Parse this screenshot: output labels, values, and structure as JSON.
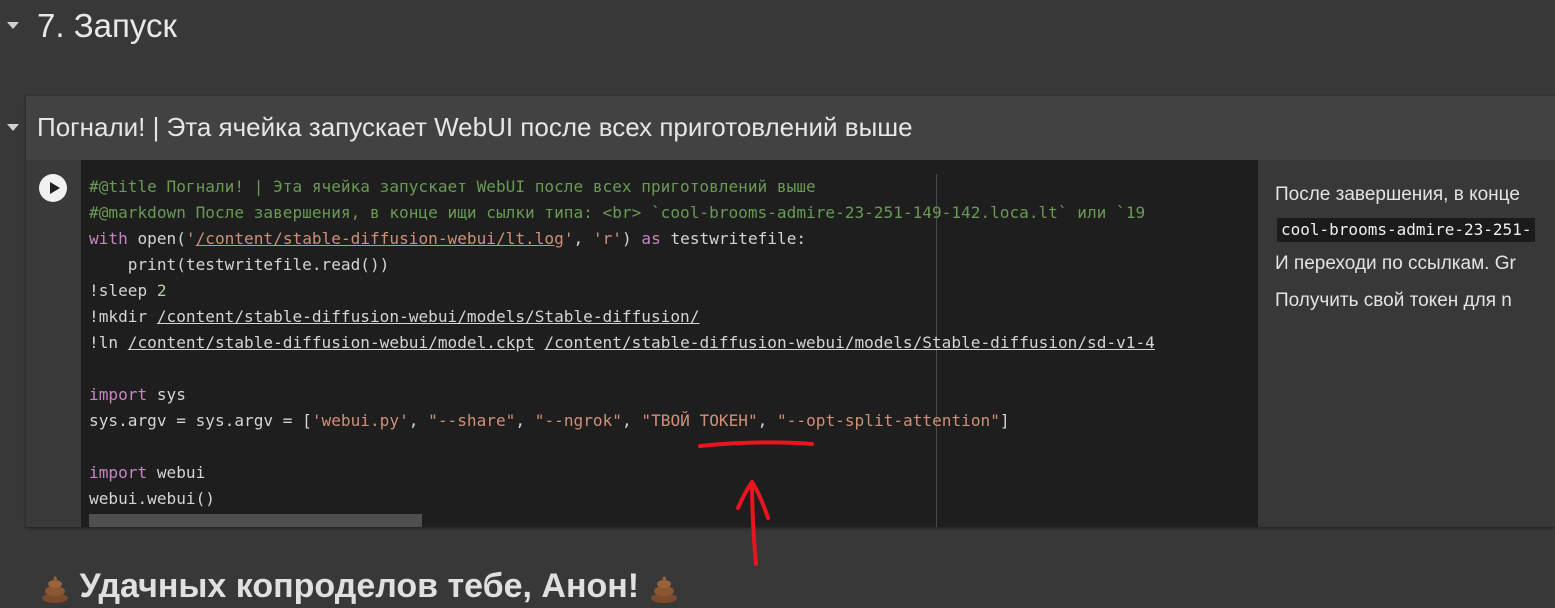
{
  "section": {
    "title": "7. Запуск"
  },
  "cell": {
    "title": "Погнали! | Эта ячейка запускает WebUI после всех приготовлений выше",
    "code": {
      "l1": "#@title Погнали! | Эта ячейка запускает WebUI после всех приготовлений выше",
      "l2a": "#@markdown После завершения, в конце ищи сылки типа: <br> `cool-brooms-admire-23-251-149-142.loca.lt` или `19",
      "l3_kw1": "with",
      "l3_a": " open(",
      "l3_q1": "'",
      "l3_path": "/content/stable-diffusion-webui/lt.log",
      "l3_q2": "'",
      "l3_b": ", ",
      "l3_r": "'r'",
      "l3_c": ") ",
      "l3_kw2": "as",
      "l3_d": " testwritefile:",
      "l4": "    print(testwritefile.read())",
      "l5_a": "!sleep ",
      "l5_n": "2",
      "l6_a": "!mkdir ",
      "l6_p": "/content/stable-diffusion-webui/models/Stable-diffusion/",
      "l7_a": "!ln ",
      "l7_p1": "/content/stable-diffusion-webui/model.ckpt",
      "l7_sp": " ",
      "l7_p2": "/content/stable-diffusion-webui/models/Stable-diffusion/sd-v1-4",
      "l9_kw": "import",
      "l9_a": " sys",
      "l10_a": "sys.argv = sys.argv = [",
      "l10_s1": "'webui.py'",
      "l10_c1": ", ",
      "l10_s2": "\"--share\"",
      "l10_c2": ", ",
      "l10_s3": "\"--ngrok\"",
      "l10_c3": ", ",
      "l10_s4": "\"ТВОЙ ТОКЕН\"",
      "l10_c4": ", ",
      "l10_s5": "\"--opt-split-attention\"",
      "l10_end": "]",
      "l12_kw": "import",
      "l12_a": " webui",
      "l13": "webui.webui()"
    },
    "form": {
      "line1": "После завершения, в конце",
      "code_chip": "cool-brooms-admire-23-251-",
      "line3": "И переходи по ссылкам. Gr",
      "line4": "Получить свой токен для n"
    }
  },
  "footer": {
    "text": "Удачных копроделов тебе, Анон!"
  },
  "colors": {
    "background": "#383838",
    "editor": "#1e1e1e",
    "comment": "#6a9955",
    "keyword": "#c586c0",
    "string": "#ce9178",
    "annotation": "#e8141e"
  },
  "icons": {
    "run": "play-circle-icon",
    "toggle": "caret-down-icon",
    "emoji": "pile-of-poo-icon"
  }
}
